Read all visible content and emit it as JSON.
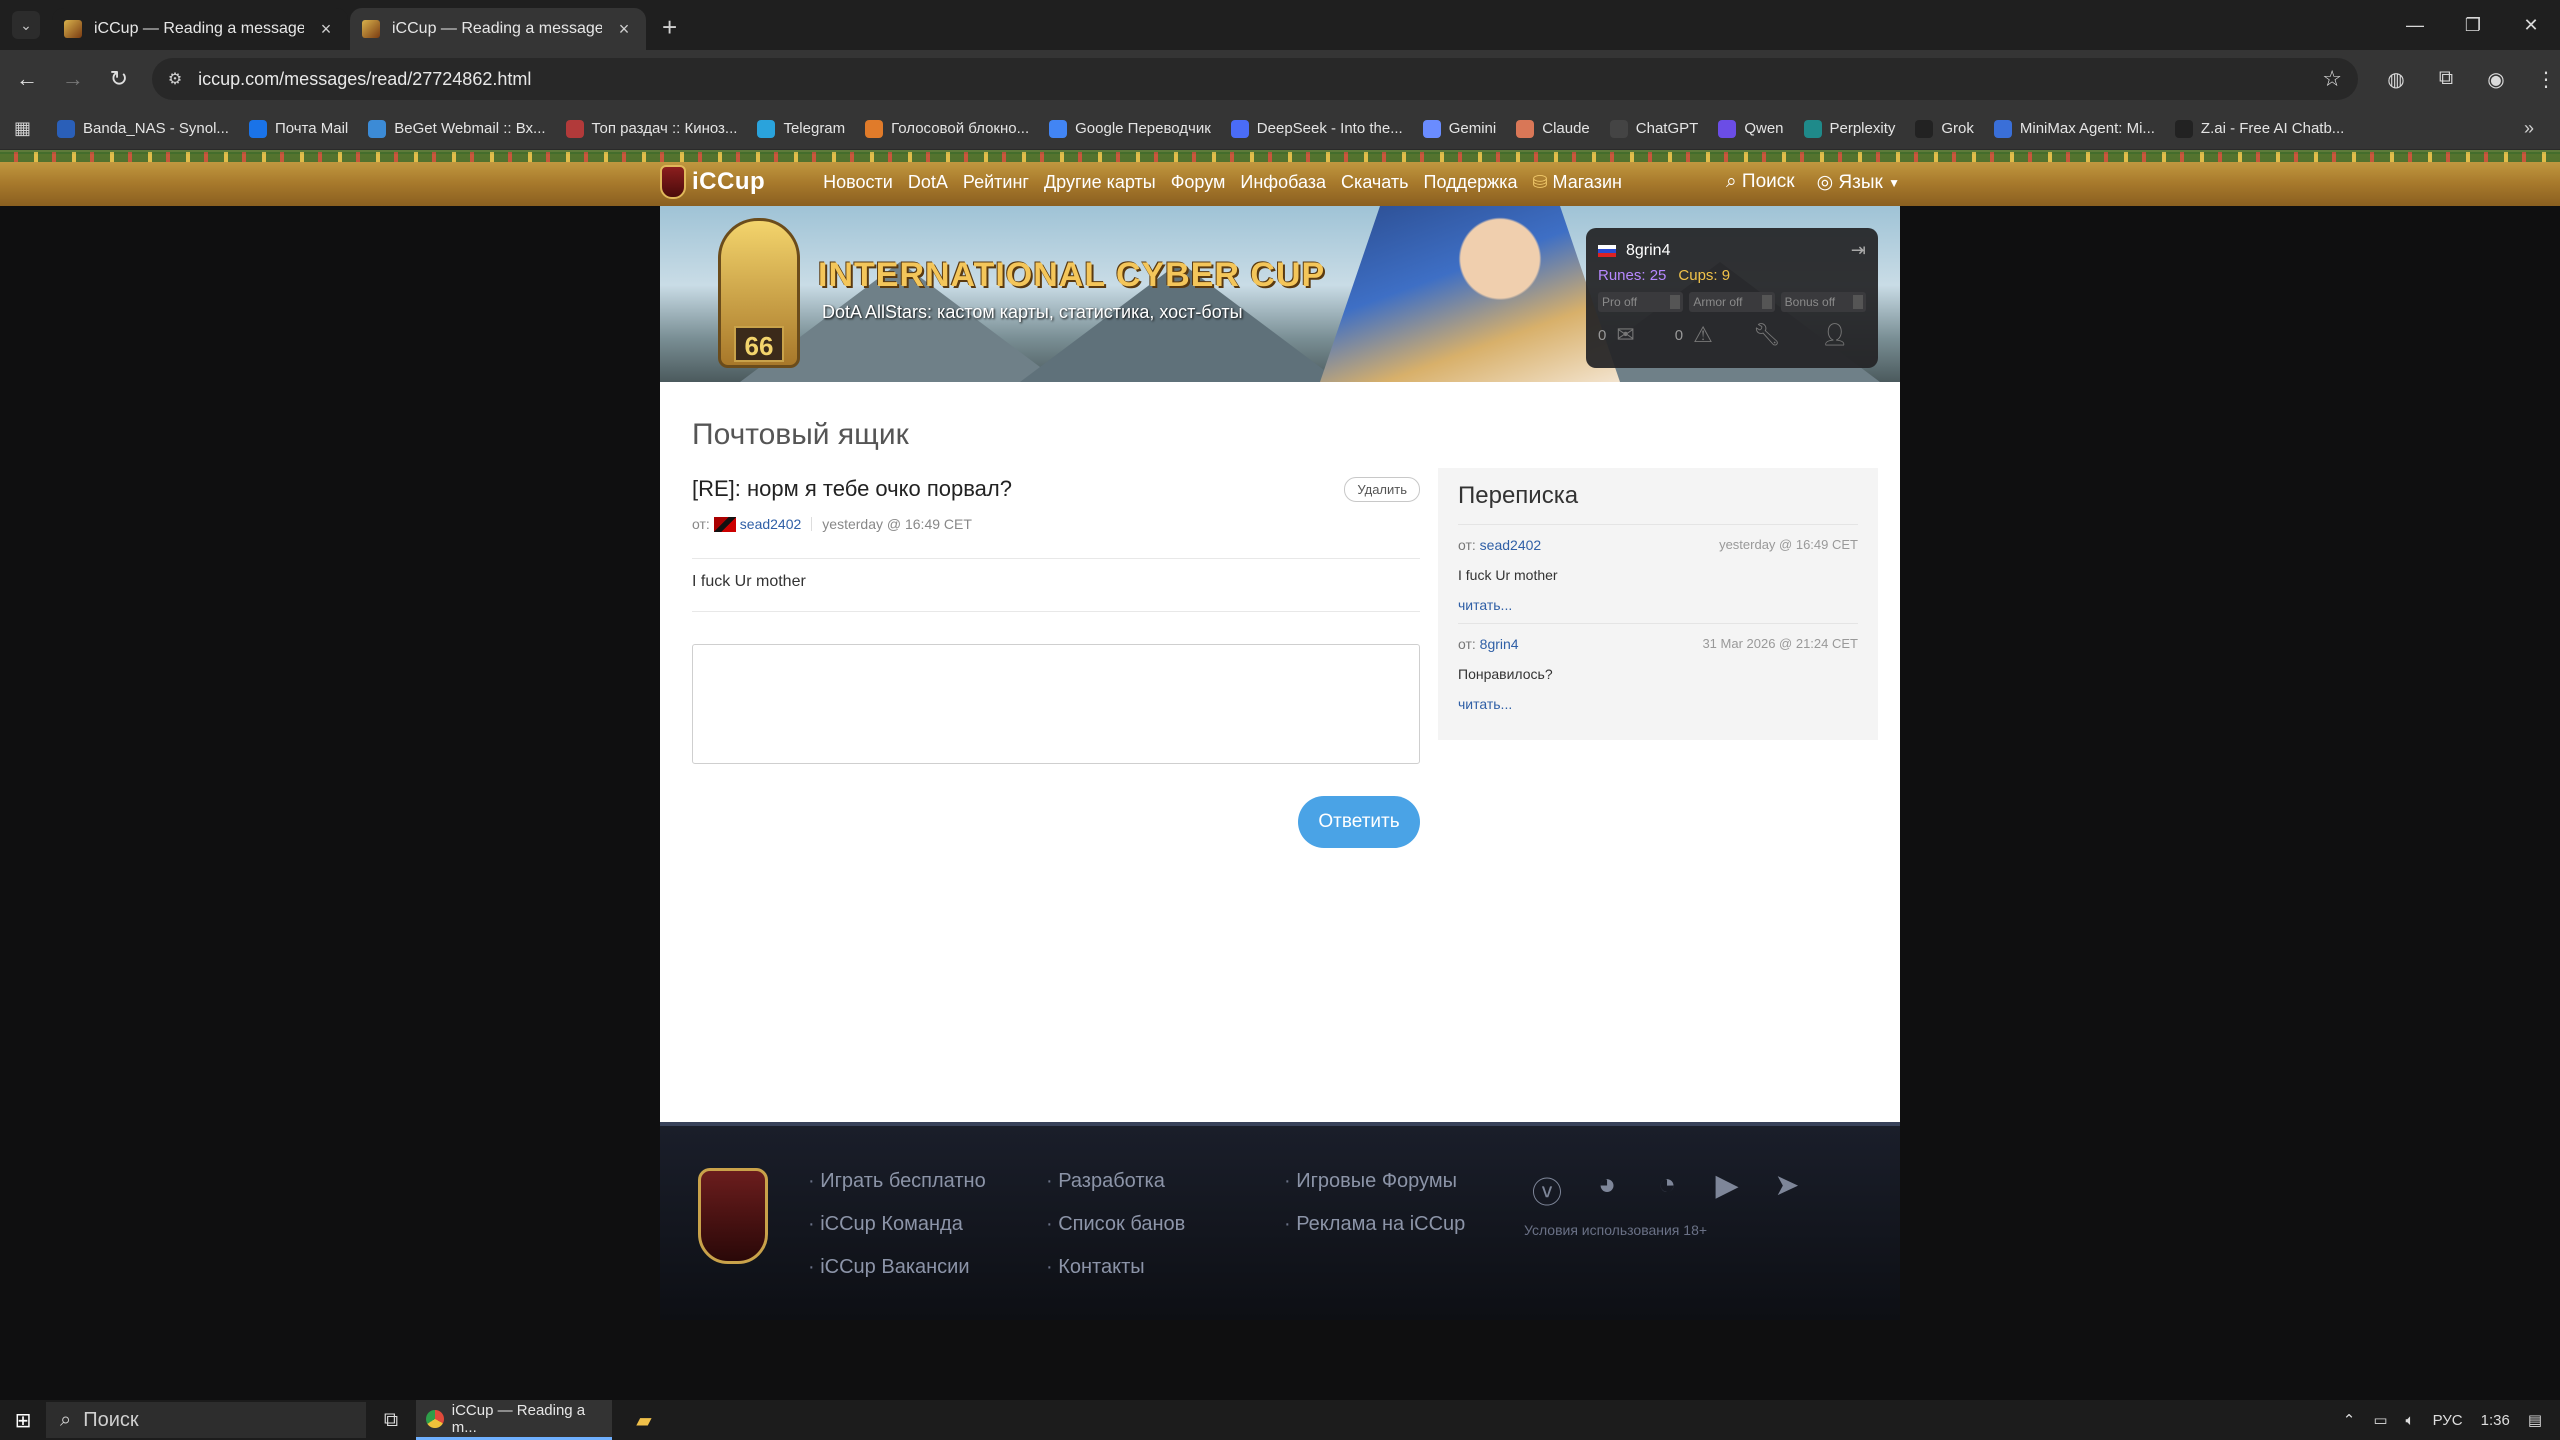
{
  "browser": {
    "tabs": [
      {
        "title": "iCCup — Reading a message fr",
        "active": false
      },
      {
        "title": "iCCup — Reading a message fr",
        "active": true
      }
    ],
    "url": "iccup.com/messages/read/27724862.html",
    "bookmarks": [
      {
        "label": "Banda_NAS - Synol...",
        "color": "#2a5fb8"
      },
      {
        "label": "Почта Mail",
        "color": "#1a73e8"
      },
      {
        "label": "BeGet Webmail :: Вх...",
        "color": "#3c8bd6"
      },
      {
        "label": "Топ раздач :: Киноз...",
        "color": "#b23a3a"
      },
      {
        "label": "Telegram",
        "color": "#2aa3dc"
      },
      {
        "label": "Голосовой блокно...",
        "color": "#e07b2a"
      },
      {
        "label": "Google Переводчик",
        "color": "#4285f4"
      },
      {
        "label": "DeepSeek - Into the...",
        "color": "#4a6cf7"
      },
      {
        "label": "Gemini",
        "color": "#6a8cff"
      },
      {
        "label": "Claude",
        "color": "#d97757"
      },
      {
        "label": "ChatGPT",
        "color": "#444444"
      },
      {
        "label": "Qwen",
        "color": "#6b4de6"
      },
      {
        "label": "Perplexity",
        "color": "#1f8a8a"
      },
      {
        "label": "Grok",
        "color": "#222222"
      },
      {
        "label": "MiniMax Agent: Mi...",
        "color": "#3a6fd8"
      },
      {
        "label": "Z.ai - Free AI Chatb...",
        "color": "#222222"
      }
    ]
  },
  "site": {
    "logo": "iCCup",
    "nav": [
      "Новости",
      "DotA",
      "Рейтинг",
      "Другие карты",
      "Форум",
      "Инфобаза",
      "Скачать",
      "Поддержка",
      "Магазин"
    ],
    "search_label": "Поиск",
    "lang_label": "Язык",
    "banner": {
      "title": "INTERNATIONAL CYBER CUP",
      "subtitle": "DotA AllStars: кастом карты, статистика, хост-боты",
      "level": "66"
    },
    "user_panel": {
      "username": "8grin4",
      "runes": "Runes: 25",
      "cups": "Cups: 9",
      "toggles": [
        "Pro off",
        "Armor off",
        "Bonus off"
      ],
      "messages_count": "0",
      "alerts_count": "0"
    }
  },
  "mailbox": {
    "page_title": "Почтовый ящик",
    "subject": "[RE]: норм я тебе очко порвал?",
    "delete_label": "Удалить",
    "from_label": "от:",
    "from_user": "sead2402",
    "date": "yesterday @ 16:49 CET",
    "body": "I fuck Ur mother",
    "reply_label": "Ответить"
  },
  "thread": {
    "title": "Переписка",
    "items": [
      {
        "from_label": "от:",
        "user": "sead2402",
        "date": "yesterday @ 16:49 CET",
        "text": "I fuck Ur mother",
        "read": "читать..."
      },
      {
        "from_label": "от:",
        "user": "8grin4",
        "date": "31 Mar 2026 @ 21:24 CET",
        "text": "Понравилось?",
        "read": "читать..."
      }
    ]
  },
  "footer": {
    "col1": [
      "Играть бесплатно",
      "iCCup Команда",
      "iCCup Вакансии"
    ],
    "col2": [
      "Разработка",
      "Список банов",
      "Контакты"
    ],
    "col3": [
      "Игровые Форумы",
      "Реклама на iCCup"
    ],
    "terms": "Условия использования 18+"
  },
  "taskbar": {
    "search": "Поиск",
    "app": "iCCup — Reading a m...",
    "lang": "РУС",
    "time": "1:36"
  }
}
